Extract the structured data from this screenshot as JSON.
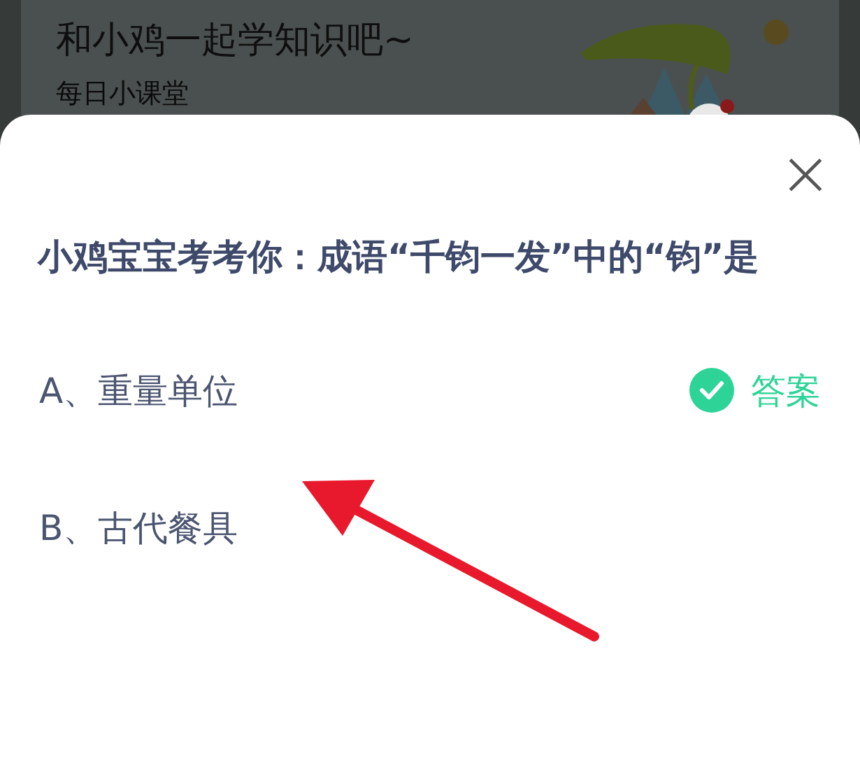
{
  "header": {
    "title": "和小鸡一起学知识吧~",
    "subtitle": "每日小课堂"
  },
  "quiz": {
    "question": "小鸡宝宝考考你：成语“千钧一发”中的“钧”是",
    "options": [
      {
        "label": "A、重量单位",
        "correct": true,
        "answer_label": "答案"
      },
      {
        "label": "B、古代餐具",
        "correct": false
      }
    ]
  }
}
